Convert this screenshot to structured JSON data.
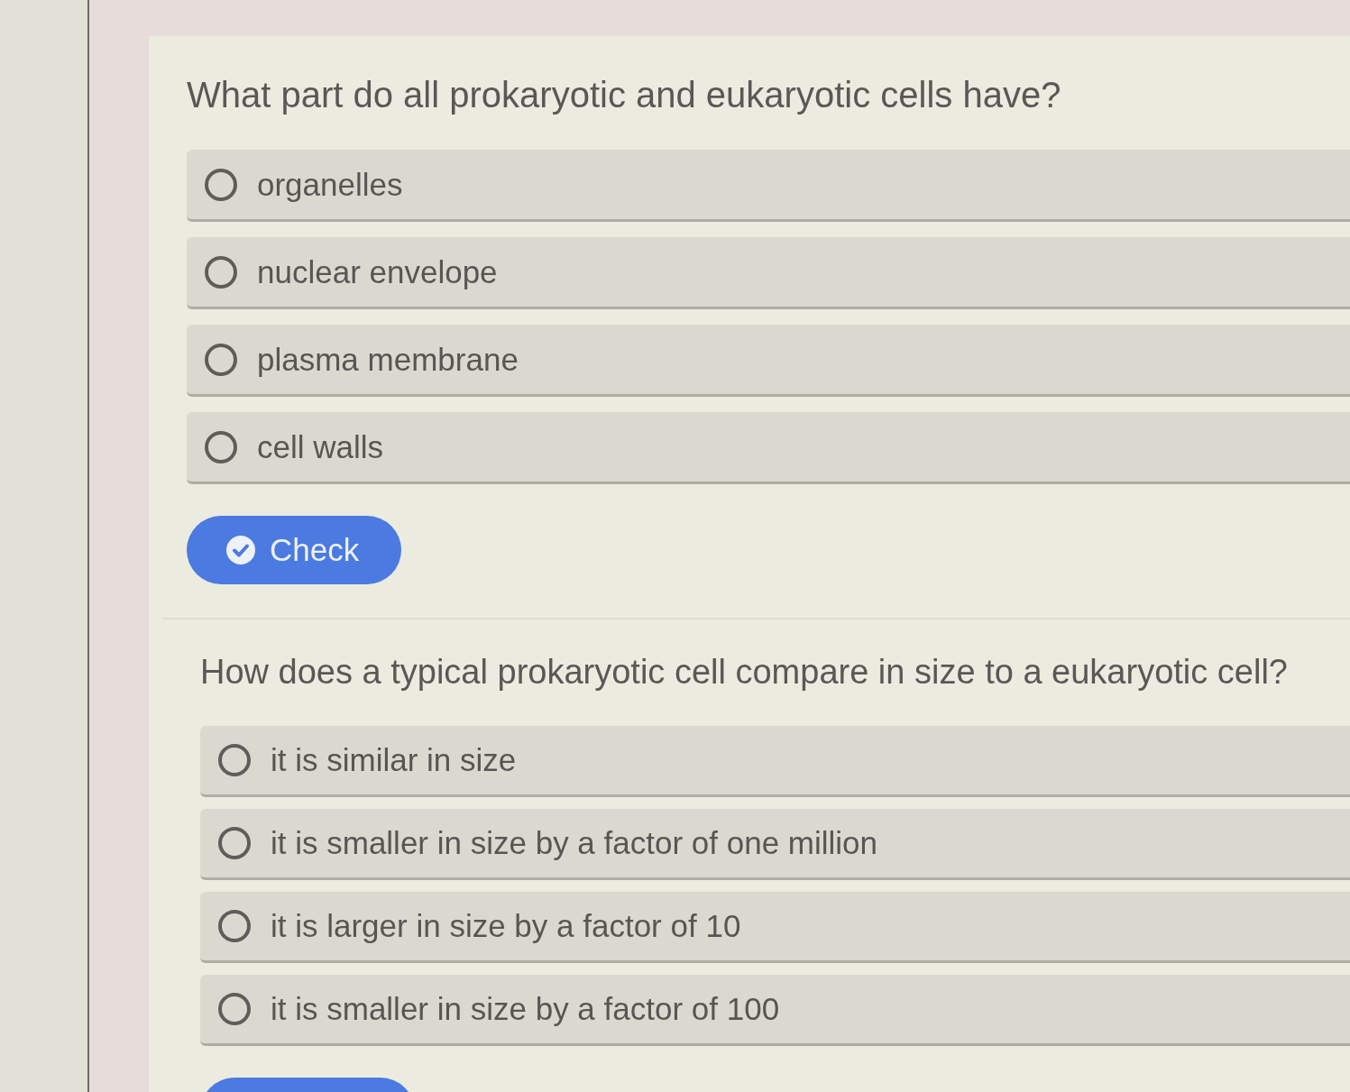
{
  "questions": [
    {
      "prompt": "What part do all prokaryotic and eukaryotic cells have?",
      "options": [
        {
          "text": "organelles",
          "selected": false
        },
        {
          "text": "nuclear envelope",
          "selected": false
        },
        {
          "text": "plasma membrane",
          "selected": false
        },
        {
          "text": "cell walls",
          "selected": false
        }
      ],
      "check_button": {
        "label": "Check"
      }
    },
    {
      "prompt": "How does a typical prokaryotic cell compare in size to a eukaryotic cell?",
      "options": [
        {
          "text": "it is similar in size",
          "selected": false
        },
        {
          "text": "it is smaller in size by a factor of one million",
          "selected": false
        },
        {
          "text": "it is larger in size by a factor of 10",
          "selected": false
        },
        {
          "text": "it is smaller in size by a factor of 100",
          "selected": false
        }
      ]
    }
  ]
}
